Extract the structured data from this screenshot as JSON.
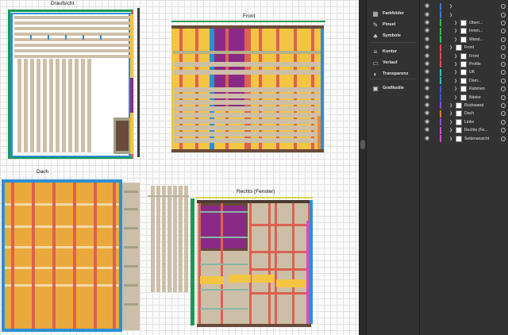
{
  "artboards": {
    "top": "Draufsicht",
    "front": "Front",
    "roof": "Dach",
    "right": "Rechts (Fenster)"
  },
  "sidebar": [
    {
      "label": "Farbfelder",
      "icon": "swatches-icon",
      "glyph": "▦"
    },
    {
      "label": "Pinsel",
      "icon": "brush-icon",
      "glyph": "✎"
    },
    {
      "label": "Symbole",
      "icon": "symbols-icon",
      "glyph": "♣"
    },
    {
      "label": "Kontur",
      "icon": "stroke-icon",
      "glyph": "≡"
    },
    {
      "label": "Verlauf",
      "icon": "gradient-icon",
      "glyph": "▭"
    },
    {
      "label": "Transparenz",
      "icon": "transparency-icon",
      "glyph": "◐"
    },
    {
      "label": "Grafikstile",
      "icon": "graphic-styles-icon",
      "glyph": "▣"
    }
  ],
  "layers": [
    {
      "name": "",
      "color": "#3a7bd5",
      "indent": 0,
      "thumb": false
    },
    {
      "name": "",
      "color": "#3a7bd5",
      "indent": 0,
      "thumb": false
    },
    {
      "name": "Oberr...",
      "color": "#2fbf4a",
      "indent": 1,
      "thumb": true
    },
    {
      "name": "Innen...",
      "color": "#2fbf4a",
      "indent": 1,
      "thumb": true
    },
    {
      "name": "Wand...",
      "color": "#2fbf4a",
      "indent": 1,
      "thumb": true
    },
    {
      "name": "Front",
      "color": "#e05050",
      "indent": 0,
      "thumb": true
    },
    {
      "name": "Front",
      "color": "#e05050",
      "indent": 1,
      "thumb": true
    },
    {
      "name": "Profile",
      "color": "#e05050",
      "indent": 1,
      "thumb": true
    },
    {
      "name": "UK",
      "color": "#2ec0c0",
      "indent": 1,
      "thumb": true
    },
    {
      "name": "Däm...",
      "color": "#2ec0c0",
      "indent": 1,
      "thumb": true
    },
    {
      "name": "Rahmen",
      "color": "#3a5bd5",
      "indent": 1,
      "thumb": true
    },
    {
      "name": "Bänke",
      "color": "#3a5bd5",
      "indent": 1,
      "thumb": true
    },
    {
      "name": "Rückwand",
      "color": "#8a4fd5",
      "indent": 0,
      "thumb": true
    },
    {
      "name": "Dach",
      "color": "#e07a30",
      "indent": 0,
      "thumb": true
    },
    {
      "name": "Links",
      "color": "#8a4fd5",
      "indent": 0,
      "thumb": true
    },
    {
      "name": "Rechts (Fe...",
      "color": "#d04fd0",
      "indent": 0,
      "thumb": true
    },
    {
      "name": "Seitenansicht",
      "color": "#d04fd0",
      "indent": 0,
      "thumb": true
    }
  ],
  "colors": {
    "wood": "#cdbfa7",
    "insulation": "#f4c542",
    "roof_orange": "#eaa93c",
    "profile_red": "#dd6152",
    "back_purple": "#8b2a86",
    "frame_blue": "#2d8fd5",
    "frame_green": "#189a52",
    "frame_brown": "#6a4a3b",
    "bench_gray": "#a2a089"
  }
}
